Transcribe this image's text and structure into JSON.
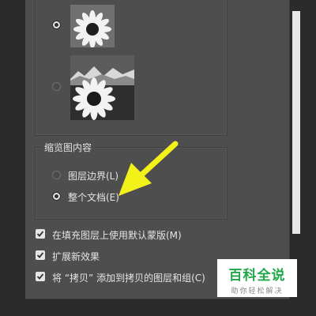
{
  "thumbnail_section": {
    "options": [
      {
        "selected": true,
        "image": "sunflower-small"
      },
      {
        "selected": false,
        "image": "sunflower-landscape"
      }
    ]
  },
  "content_group": {
    "title": "缩览图内容",
    "options": [
      {
        "label": "图层边界(L)",
        "selected": false
      },
      {
        "label": "整个文档(E)",
        "selected": true
      }
    ]
  },
  "checkboxes": [
    {
      "label": "在填充图层上使用默认蒙版(M)",
      "checked": true
    },
    {
      "label": "扩展新效果",
      "checked": true
    },
    {
      "label": "将 “拷贝” 添加到拷贝的图层和组(C)",
      "checked": true
    }
  ],
  "watermark": {
    "title": "百科全说",
    "subtitle": "助你轻松解决"
  },
  "colors": {
    "panel": "#4e4e4e",
    "arrow": "#f2f21a",
    "watermark_green": "#21a64a"
  }
}
